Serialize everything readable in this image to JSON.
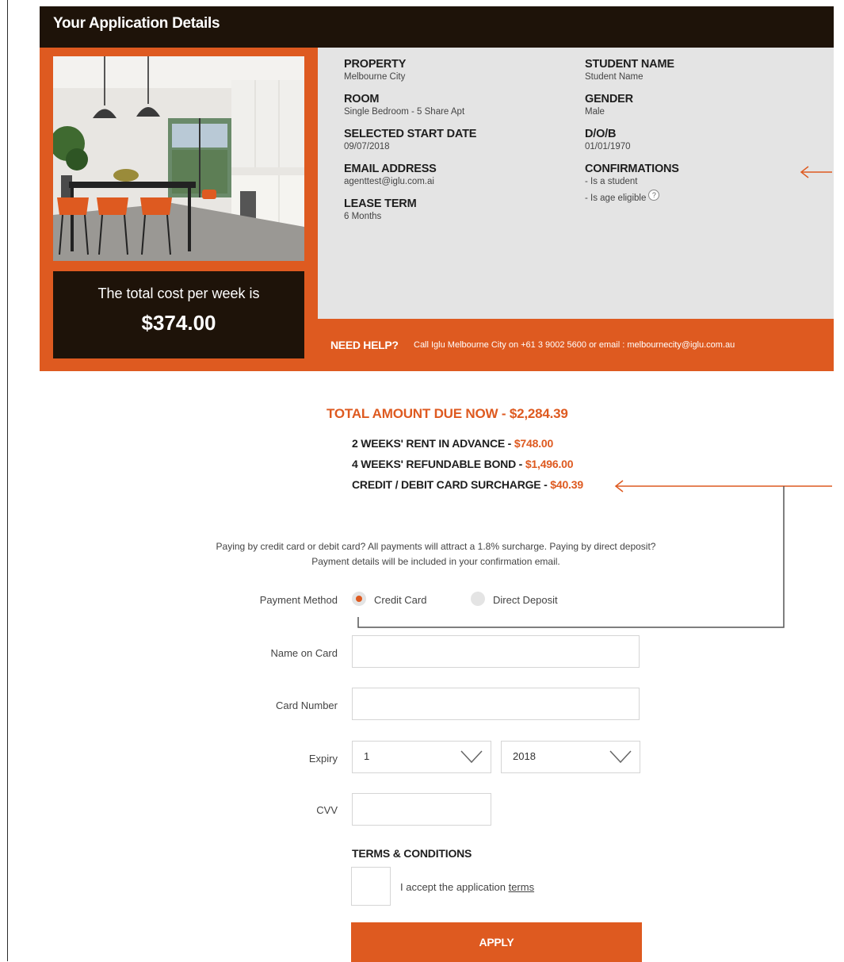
{
  "header": {
    "title": "Your Application Details"
  },
  "cost": {
    "label": "The total cost per week is",
    "value": "$374.00"
  },
  "details": {
    "col1": [
      {
        "label": "PROPERTY",
        "value": "Melbourne City"
      },
      {
        "label": "ROOM",
        "value": "Single Bedroom - 5 Share Apt"
      },
      {
        "label": "SELECTED START DATE",
        "value": "09/07/2018"
      },
      {
        "label": "EMAIL ADDRESS",
        "value": "agenttest@iglu.com.ai"
      },
      {
        "label": "LEASE TERM",
        "value": "6 Months"
      }
    ],
    "col2": [
      {
        "label": "STUDENT NAME",
        "value": "Student Name"
      },
      {
        "label": "GENDER",
        "value": "Male"
      },
      {
        "label": "D/O/B",
        "value": "01/01/1970"
      }
    ],
    "confirmations": {
      "label": "CONFIRMATIONS",
      "items": [
        "- Is a student",
        "- Is age eligible"
      ]
    }
  },
  "help": {
    "title": "NEED HELP?",
    "text": "Call Iglu Melbourne City on +61 3 9002 5600 or email : melbournecity@iglu.com.au"
  },
  "totals": {
    "due": "TOTAL AMOUNT DUE NOW - $2,284.39",
    "items": [
      {
        "label": "2 WEEKS' RENT IN ADVANCE - ",
        "amount": "$748.00"
      },
      {
        "label": "4 WEEKS' REFUNDABLE BOND - ",
        "amount": "$1,496.00"
      },
      {
        "label": "CREDIT / DEBIT CARD SURCHARGE - ",
        "amount": "$40.39"
      }
    ]
  },
  "note": "Paying by credit card or debit card? All payments will attract a 1.8% surcharge. Paying by direct deposit? Payment details will be included in your confirmation email.",
  "form": {
    "payment_method_label": "Payment Method",
    "options": [
      "Credit Card",
      "Direct Deposit"
    ],
    "selected_option": "Credit Card",
    "name_label": "Name on Card",
    "name_value": "",
    "card_label": "Card Number",
    "card_value": "",
    "expiry_label": "Expiry",
    "expiry_month": "1",
    "expiry_year": "2018",
    "cvv_label": "CVV",
    "cvv_value": ""
  },
  "terms": {
    "title": "TERMS & CONDITIONS",
    "accept_text": "I accept the application ",
    "link": "terms"
  },
  "apply_label": "APPLY",
  "colors": {
    "accent": "#de5a20",
    "dark": "#1e1309",
    "panel": "#e4e4e4"
  }
}
